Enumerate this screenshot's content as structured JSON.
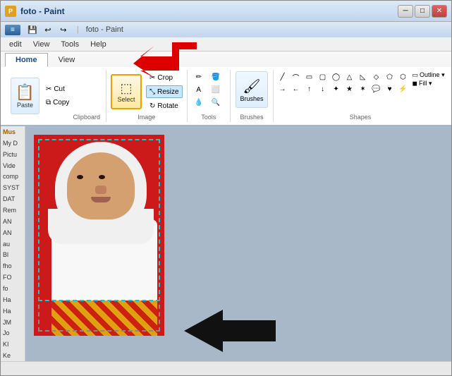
{
  "window": {
    "title": "foto - Paint",
    "menu": {
      "items": [
        "edit",
        "View",
        "Tools",
        "Help"
      ]
    }
  },
  "ribbon": {
    "app_btn": "≡",
    "tabs": [
      "Home",
      "View"
    ],
    "active_tab": "Home",
    "groups": {
      "clipboard": {
        "label": "Clipboard",
        "paste": "Paste",
        "cut": "Cut",
        "copy": "Copy"
      },
      "image": {
        "label": "Image",
        "select": "Select",
        "crop": "Crop",
        "resize": "Resize",
        "rotate": "Rotate"
      },
      "tools": {
        "label": "Tools"
      },
      "brushes": {
        "label": "Brushes",
        "brushes": "Brushes"
      },
      "shapes": {
        "label": "Shapes",
        "outline": "Outline ▾",
        "fill": "Fill ▾"
      }
    }
  },
  "sidebar": {
    "items": [
      {
        "label": "Mus"
      },
      {
        "label": "My D"
      },
      {
        "label": "Pictu"
      },
      {
        "label": "Vide"
      },
      {
        "label": "comp"
      },
      {
        "label": "SYST"
      },
      {
        "label": "DAT"
      },
      {
        "label": "Rem"
      },
      {
        "label": "AN"
      },
      {
        "label": "AN"
      },
      {
        "label": "au"
      },
      {
        "label": "Bl"
      },
      {
        "label": "fho"
      },
      {
        "label": "FO"
      },
      {
        "label": "fo"
      },
      {
        "label": "Ha"
      },
      {
        "label": "Ha"
      },
      {
        "label": "JM"
      },
      {
        "label": "Jo"
      },
      {
        "label": "KI"
      },
      {
        "label": "Ke"
      }
    ]
  },
  "status_bar": {
    "text": ""
  },
  "shapes": [
    "▭",
    "▱",
    "△",
    "▷",
    "▽",
    "◁",
    "⬠",
    "⬡",
    "⬟",
    "☆",
    "⌬",
    "⬭",
    "⌒",
    "➚",
    "→",
    "↘",
    "◯",
    "⬜",
    "▢",
    "⬟"
  ],
  "tools": [
    "✏",
    "✏",
    "⌫",
    "⬧",
    "A",
    "◎",
    "⟳",
    "🪣",
    "✂",
    "🔍"
  ]
}
